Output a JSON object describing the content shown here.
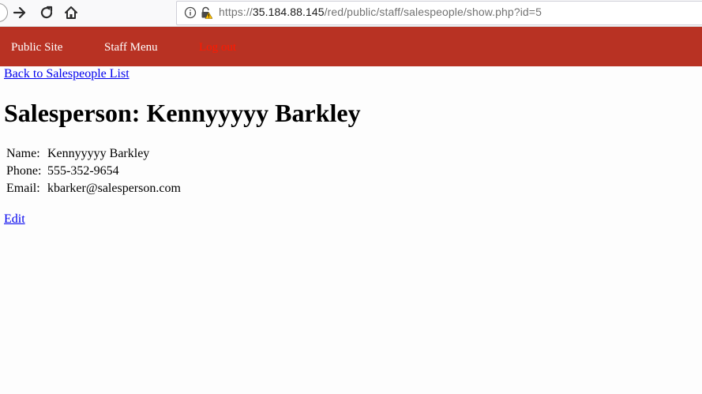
{
  "browser": {
    "url_scheme": "https://",
    "url_host": "35.184.88.145",
    "url_path": "/red/public/staff/salespeople/show.php?id=5"
  },
  "site_nav": {
    "public_site": "Public Site",
    "staff_menu": "Staff Menu",
    "logout": "Log out"
  },
  "page": {
    "back_link": "Back to Salespeople List",
    "title": "Salesperson: Kennyyyyy Barkley",
    "details": [
      {
        "label": "Name:",
        "value": "Kennyyyyy Barkley"
      },
      {
        "label": "Phone:",
        "value": "555-352-9654"
      },
      {
        "label": "Email:",
        "value": "kbarker@salesperson.com"
      }
    ],
    "edit_link": "Edit"
  },
  "colors": {
    "nav_bar": "#b83223",
    "nav_link": "#ffffff",
    "logout_link": "#ff1a00",
    "hyperlink": "#0000ee"
  }
}
